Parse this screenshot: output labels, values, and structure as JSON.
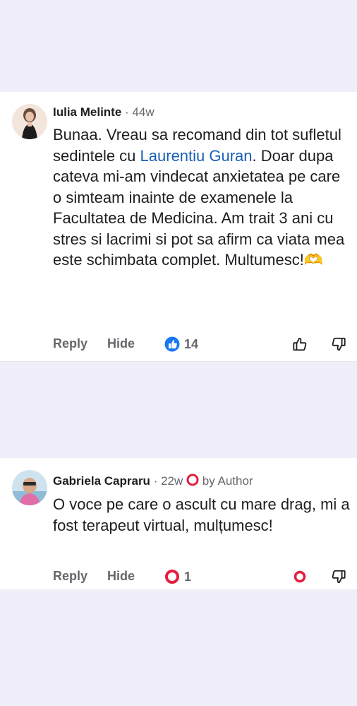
{
  "comments": [
    {
      "author": "Iulia Melinte",
      "time": "· 44w",
      "text_before": "Bunaa. Vreau sa recomand din tot sufletul sedintele cu ",
      "mention": "Laurentiu Guran",
      "text_after": ". Doar dupa cateva mi-am vindecat anxietatea pe care o simteam inainte de examenele la Facultatea de Medicina. Am trait 3 ani cu stres si lacrimi si pot sa afirm ca viata mea este schimbata complet. Multumesc!",
      "emoji": "🫶",
      "reply_label": "Reply",
      "hide_label": "Hide",
      "reaction_icon": "like-icon",
      "reaction_count": "14"
    },
    {
      "author": "Gabriela Capraru",
      "time": "· 22w",
      "badge": "by Author",
      "text": "O voce pe care o ascult cu mare drag, mi a fost terapeut virtual, mulțumesc!",
      "reply_label": "Reply",
      "hide_label": "Hide",
      "reaction_icon": "heart-icon",
      "reaction_count": "1"
    }
  ],
  "colors": {
    "accent_blue": "#1a5fb4",
    "like_blue": "#1877f2",
    "heart_red": "#e41e3f",
    "page_bg": "#f0eef8"
  }
}
